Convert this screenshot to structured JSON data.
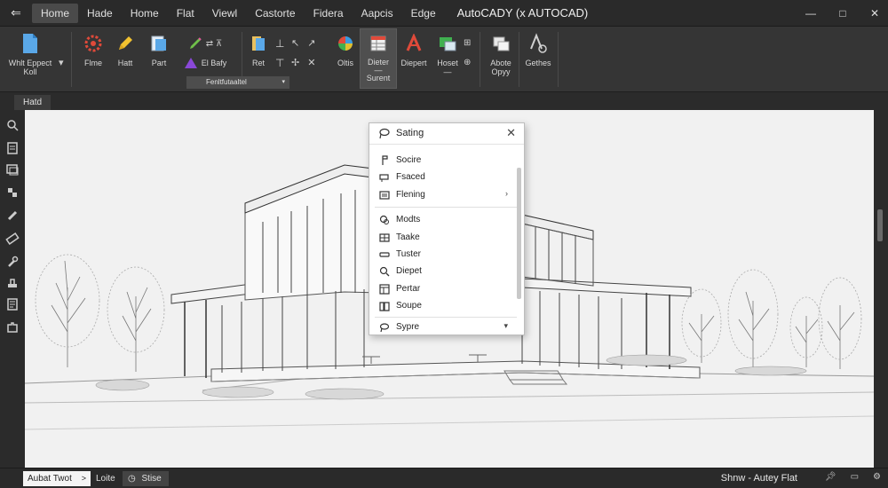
{
  "app": {
    "title": "AutoCADY (x AUTOCAD)",
    "accent_color": "#4a4a4a"
  },
  "menu": {
    "back_icon": "arrow-left-icon",
    "tabs": [
      "Home",
      "Hade",
      "Home",
      "Flat",
      "Viewl",
      "Castorte",
      "Fidera",
      "Aapcis",
      "Edge"
    ]
  },
  "window_controls": {
    "minimize": "—",
    "maximize": "□",
    "close": "✕"
  },
  "ribbon": {
    "buttons": [
      {
        "label": "Whlt Eppect\nKoll",
        "icon": "document-icon"
      },
      {
        "label": "Flme",
        "icon": "flame-icon"
      },
      {
        "label": "Hatt",
        "icon": "pencil-icon"
      },
      {
        "label": "Part",
        "icon": "page-icon"
      },
      {
        "label": "El Bafy",
        "icon": "triangle-icon"
      },
      {
        "label": "Ret",
        "icon": "book-icon"
      },
      {
        "label": "Oltis",
        "icon": "circle-icon"
      },
      {
        "label": "Dieter\n—\nSurent",
        "icon": "table-icon"
      },
      {
        "label": "Diepert",
        "icon": "text-a-icon"
      },
      {
        "label": "Hoset\n—",
        "icon": "image-icon"
      },
      {
        "label": "Abote\nOpyy",
        "icon": "copy-icon"
      },
      {
        "label": "Gethes",
        "icon": "text-style-icon"
      }
    ],
    "group_label": "Fenltfutaaltel"
  },
  "doc_tab": {
    "label": "Hatd"
  },
  "context_menu": {
    "header": "Sating",
    "close": "✕",
    "items": [
      {
        "label": "Socire",
        "icon": "scroll-icon"
      },
      {
        "label": "Fsaced",
        "icon": "eraser-icon"
      },
      {
        "label": "Flening",
        "icon": "list-icon",
        "has_submenu": true
      },
      {
        "label": "Modts",
        "icon": "circles-icon"
      },
      {
        "label": "Taake",
        "icon": "grid-icon"
      },
      {
        "label": "Tuster",
        "icon": "rectangle-icon"
      },
      {
        "label": "Diepet",
        "icon": "magnifier-icon"
      },
      {
        "label": "Pertar",
        "icon": "table-icon"
      },
      {
        "label": "Soupe",
        "icon": "book-icon"
      },
      {
        "label": "Sypre",
        "icon": "lasso-icon"
      }
    ],
    "submenu_arrow": "›",
    "more_arrow": "▾"
  },
  "status": {
    "command": "Aubat Twot",
    "command_caret": ">",
    "left_item": "Loite",
    "style": "Stise",
    "right_text": "Shnw - Autey Flat"
  },
  "colors": {
    "canvas": "#f1f1f1",
    "ribbon": "#353535",
    "titlebar": "#2a2a2a"
  }
}
